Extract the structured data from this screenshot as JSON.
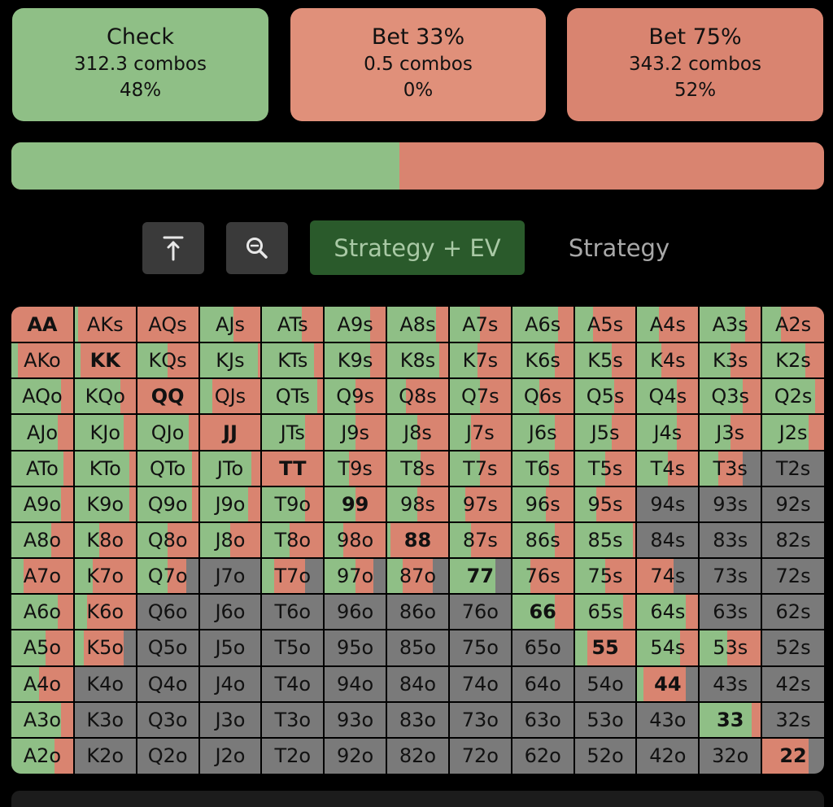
{
  "actions": [
    {
      "title": "Check",
      "combos": "312.3 combos",
      "pct": "48%",
      "color": "#8fbf86"
    },
    {
      "title": "Bet 33%",
      "combos": "0.5 combos",
      "pct": "0%",
      "color": "#e0907a"
    },
    {
      "title": "Bet 75%",
      "combos": "343.2 combos",
      "pct": "52%",
      "color": "#d98470"
    }
  ],
  "frequency_bar": {
    "check_fraction": 0.477,
    "check_color": "#8fbf86",
    "bet_color": "#d98470"
  },
  "toolbar": {
    "collapse_icon": "arrow-up-to-line-icon",
    "zoom_icon": "zoom-out-icon",
    "mode_active": "Strategy + EV",
    "mode_other": "Strategy"
  },
  "colors": {
    "check": "#8fbf86",
    "bet33": "#e0907a",
    "bet75": "#d98470",
    "none": "#7a7a7a",
    "grid_gap": "#000000"
  },
  "hand_grid": {
    "ranks": [
      "A",
      "K",
      "Q",
      "J",
      "T",
      "9",
      "8",
      "7",
      "6",
      "5",
      "4",
      "3",
      "2"
    ],
    "rows": [
      [
        "AA",
        "AKs",
        "AQs",
        "AJs",
        "ATs",
        "A9s",
        "A8s",
        "A7s",
        "A6s",
        "A5s",
        "A4s",
        "A3s",
        "A2s"
      ],
      [
        "AKo",
        "KK",
        "KQs",
        "KJs",
        "KTs",
        "K9s",
        "K8s",
        "K7s",
        "K6s",
        "K5s",
        "K4s",
        "K3s",
        "K2s"
      ],
      [
        "AQo",
        "KQo",
        "QQ",
        "QJs",
        "QTs",
        "Q9s",
        "Q8s",
        "Q7s",
        "Q6s",
        "Q5s",
        "Q4s",
        "Q3s",
        "Q2s"
      ],
      [
        "AJo",
        "KJo",
        "QJo",
        "JJ",
        "JTs",
        "J9s",
        "J8s",
        "J7s",
        "J6s",
        "J5s",
        "J4s",
        "J3s",
        "J2s"
      ],
      [
        "ATo",
        "KTo",
        "QTo",
        "JTo",
        "TT",
        "T9s",
        "T8s",
        "T7s",
        "T6s",
        "T5s",
        "T4s",
        "T3s",
        "T2s"
      ],
      [
        "A9o",
        "K9o",
        "Q9o",
        "J9o",
        "T9o",
        "99",
        "98s",
        "97s",
        "96s",
        "95s",
        "94s",
        "93s",
        "92s"
      ],
      [
        "A8o",
        "K8o",
        "Q8o",
        "J8o",
        "T8o",
        "98o",
        "88",
        "87s",
        "86s",
        "85s",
        "84s",
        "83s",
        "82s"
      ],
      [
        "A7o",
        "K7o",
        "Q7o",
        "J7o",
        "T7o",
        "97o",
        "87o",
        "77",
        "76s",
        "75s",
        "74s",
        "73s",
        "72s"
      ],
      [
        "A6o",
        "K6o",
        "Q6o",
        "J6o",
        "T6o",
        "96o",
        "86o",
        "76o",
        "66",
        "65s",
        "64s",
        "63s",
        "62s"
      ],
      [
        "A5o",
        "K5o",
        "Q5o",
        "J5o",
        "T5o",
        "95o",
        "85o",
        "75o",
        "65o",
        "55",
        "54s",
        "53s",
        "52s"
      ],
      [
        "A4o",
        "K4o",
        "Q4o",
        "J4o",
        "T4o",
        "94o",
        "84o",
        "74o",
        "64o",
        "54o",
        "44",
        "43s",
        "42s"
      ],
      [
        "A3o",
        "K3o",
        "Q3o",
        "J3o",
        "T3o",
        "93o",
        "83o",
        "73o",
        "63o",
        "53o",
        "43o",
        "33",
        "32s"
      ],
      [
        "A2o",
        "K2o",
        "Q2o",
        "J2o",
        "T2o",
        "92o",
        "82o",
        "72o",
        "62o",
        "52o",
        "42o",
        "32o",
        "22"
      ]
    ],
    "check_freq": [
      [
        0.0,
        0.05,
        0.0,
        0.55,
        0.65,
        0.75,
        0.8,
        0.5,
        0.75,
        0.3,
        0.35,
        0.75,
        0.3
      ],
      [
        0.1,
        0.1,
        0.5,
        0.95,
        0.85,
        0.75,
        0.85,
        0.45,
        0.7,
        0.6,
        0.4,
        0.5,
        0.7
      ],
      [
        0.8,
        0.75,
        0.0,
        0.2,
        0.9,
        0.5,
        0.3,
        0.5,
        0.45,
        0.65,
        0.65,
        0.7,
        0.85
      ],
      [
        0.75,
        0.8,
        0.85,
        0.0,
        0.7,
        0.5,
        0.5,
        0.35,
        0.7,
        0.6,
        0.65,
        0.5,
        0.75
      ],
      [
        0.85,
        0.9,
        0.9,
        0.85,
        0.0,
        0.4,
        0.55,
        0.5,
        0.6,
        0.5,
        0.5,
        0.3,
        0.0
      ],
      [
        0.8,
        0.9,
        0.9,
        0.8,
        0.7,
        0.5,
        0.5,
        0.25,
        0.55,
        0.35,
        0.0,
        0.0,
        0.0
      ],
      [
        0.65,
        0.4,
        0.5,
        0.5,
        0.45,
        0.3,
        0.05,
        0.35,
        0.7,
        0.95,
        0.0,
        0.0,
        0.0
      ],
      [
        0.2,
        0.3,
        0.5,
        0.0,
        0.2,
        0.5,
        0.25,
        0.75,
        0.3,
        0.5,
        0.0,
        0.0,
        0.0
      ],
      [
        0.75,
        0.2,
        0.0,
        0.0,
        0.0,
        0.0,
        0.0,
        0.0,
        0.7,
        0.8,
        0.8,
        0.0,
        0.0
      ],
      [
        0.55,
        0.15,
        0.0,
        0.0,
        0.0,
        0.0,
        0.0,
        0.0,
        0.0,
        0.2,
        0.7,
        0.45,
        0.0
      ],
      [
        0.45,
        0.0,
        0.0,
        0.0,
        0.0,
        0.0,
        0.0,
        0.0,
        0.0,
        0.0,
        0.1,
        0.0,
        0.0
      ],
      [
        0.8,
        0.0,
        0.0,
        0.0,
        0.0,
        0.0,
        0.0,
        0.0,
        0.0,
        0.0,
        0.0,
        0.85,
        0.0
      ],
      [
        0.7,
        0.0,
        0.0,
        0.0,
        0.0,
        0.0,
        0.0,
        0.0,
        0.0,
        0.0,
        0.0,
        0.0,
        0.0
      ]
    ],
    "bet_freq": [
      [
        1.0,
        0.95,
        1.0,
        0.45,
        0.35,
        0.25,
        0.2,
        0.5,
        0.25,
        0.7,
        0.65,
        0.25,
        0.7
      ],
      [
        0.9,
        0.9,
        0.5,
        0.05,
        0.15,
        0.25,
        0.15,
        0.55,
        0.3,
        0.4,
        0.6,
        0.5,
        0.3
      ],
      [
        0.2,
        0.25,
        1.0,
        0.8,
        0.1,
        0.5,
        0.7,
        0.5,
        0.55,
        0.35,
        0.35,
        0.3,
        0.15
      ],
      [
        0.25,
        0.2,
        0.15,
        1.0,
        0.3,
        0.5,
        0.5,
        0.65,
        0.3,
        0.4,
        0.35,
        0.5,
        0.25
      ],
      [
        0.15,
        0.1,
        0.1,
        0.15,
        1.0,
        0.6,
        0.45,
        0.5,
        0.4,
        0.5,
        0.5,
        0.4,
        0.0
      ],
      [
        0.2,
        0.1,
        0.1,
        0.2,
        0.3,
        0.5,
        0.5,
        0.75,
        0.45,
        0.65,
        0.0,
        0.0,
        0.0
      ],
      [
        0.35,
        0.6,
        0.5,
        0.5,
        0.55,
        0.7,
        0.95,
        0.65,
        0.3,
        0.05,
        0.0,
        0.0,
        0.0
      ],
      [
        0.8,
        0.7,
        0.3,
        0.0,
        0.5,
        0.3,
        0.5,
        0.0,
        0.7,
        0.5,
        0.6,
        0.0,
        0.0
      ],
      [
        0.25,
        0.8,
        0.0,
        0.0,
        0.0,
        0.0,
        0.0,
        0.0,
        0.3,
        0.2,
        0.2,
        0.0,
        0.0
      ],
      [
        0.45,
        0.65,
        0.0,
        0.0,
        0.0,
        0.0,
        0.0,
        0.0,
        0.0,
        0.8,
        0.3,
        0.55,
        0.0
      ],
      [
        0.55,
        0.0,
        0.0,
        0.0,
        0.0,
        0.0,
        0.0,
        0.0,
        0.0,
        0.0,
        0.7,
        0.0,
        0.0
      ],
      [
        0.2,
        0.0,
        0.0,
        0.0,
        0.0,
        0.0,
        0.0,
        0.0,
        0.0,
        0.0,
        0.0,
        0.15,
        0.0
      ],
      [
        0.3,
        0.0,
        0.0,
        0.0,
        0.0,
        0.0,
        0.0,
        0.0,
        0.0,
        0.0,
        0.0,
        0.0,
        0.75
      ]
    ]
  }
}
